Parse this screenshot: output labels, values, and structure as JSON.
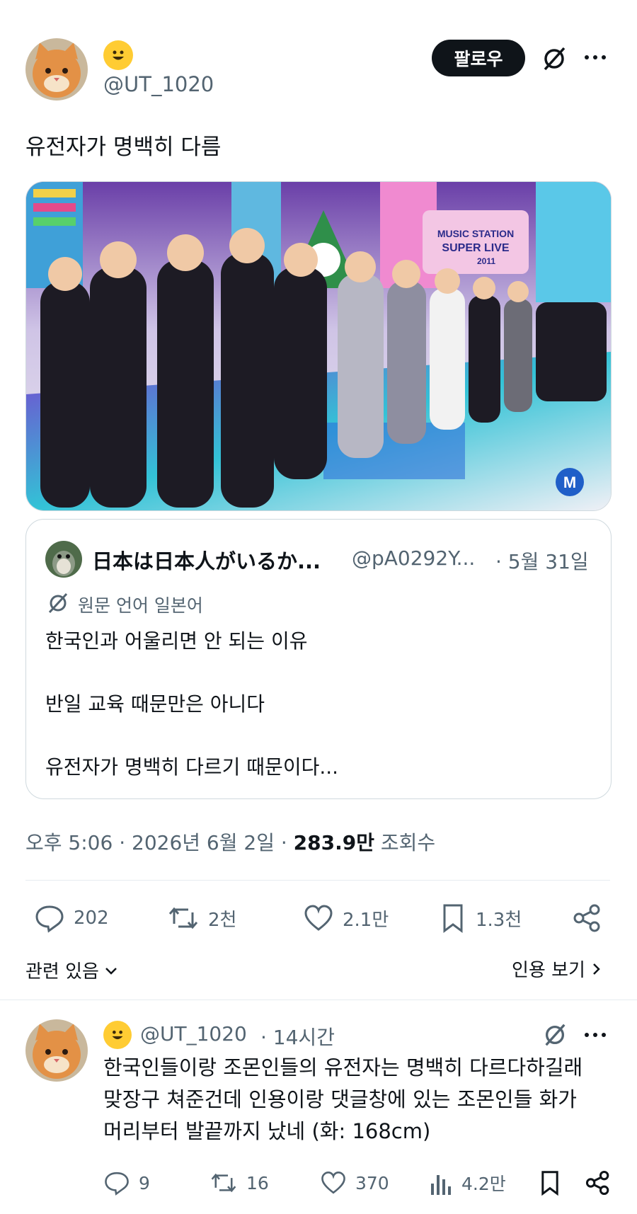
{
  "post": {
    "handle": "@UT_1020",
    "follow_label": "팔로우",
    "text": "유전자가 명백히 다름",
    "media_badge": "M",
    "stage_banner": [
      "MUSIC STATION",
      "SUPER LIVE",
      "2011"
    ],
    "timestamp": "오후 5:06 · 2026년 6월 2일 · ",
    "views_count": "283.9만",
    "views_label": " 조회수"
  },
  "quote": {
    "display_name": "日本は日本人がいるか...",
    "handle": "@pA0292Y...",
    "date": "· 5월 31일",
    "original_language": "원문 언어 일본어",
    "lines": [
      "한국인과 어울리면 안 되는 이유",
      "반일 교육 때문만은 아니다",
      "유전자가 명백히 다르기 때문이다..."
    ]
  },
  "actions": {
    "replies": "202",
    "reposts": "2천",
    "likes": "2.1만",
    "bookmarks": "1.3천"
  },
  "links": {
    "related": "관련 있음",
    "view_quotes": "인용 보기"
  },
  "reply": {
    "handle": "@UT_1020",
    "time": "· 14시간",
    "lines": [
      "한국인들이랑 조몬인들의 유전자는 명백히 다르다하길래",
      "맞장구 쳐준건데 인용이랑 댓글창에 있는 조몬인들 화가",
      "머리부터 발끝까지 났네 (화: 168cm)"
    ],
    "actions": {
      "replies": "9",
      "reposts": "16",
      "likes": "370",
      "views": "4.2만"
    }
  },
  "colors": {
    "text": "#0f1419",
    "secondary": "#536471",
    "border": "#cfd9de",
    "avatar_cat": "#d9823b",
    "emoji": "#ffcc33"
  },
  "icons": [
    "smile-emoji-icon",
    "translate-icon",
    "more-icon",
    "reply-icon",
    "repost-icon",
    "like-icon",
    "bookmark-icon",
    "share-icon",
    "views-icon",
    "chevron-down-icon",
    "chevron-right-icon"
  ]
}
